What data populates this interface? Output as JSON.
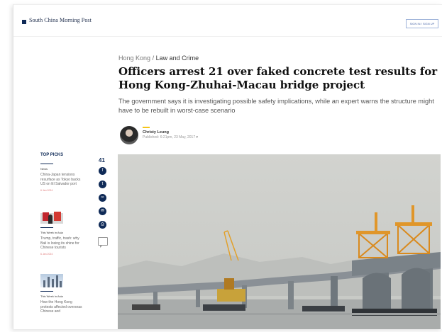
{
  "header": {
    "logo_text": "South China Morning Post",
    "signup_label": "SIGN IN / SIGN UP"
  },
  "article": {
    "breadcrumb_section": "Hong Kong",
    "breadcrumb_sep": "/",
    "breadcrumb_current": "Law and Crime",
    "headline": "Officers arrest 21 over faked concrete test results for Hong Kong-Zhuhai-Macau bridge project",
    "dek": "The government says it is investigating possible safety implications, while an expert warns the structure might have to be rebuilt in worst-case scenario",
    "author_name": "Christy Leung",
    "published": "Published: 6:21pm, 23 May, 2017"
  },
  "top_picks": {
    "title": "TOP PICKS",
    "items": [
      {
        "section": "News",
        "title": "China-Japan tensions resurface as Tokyo backs US on El Salvador port",
        "date": "6 Jan 2024"
      },
      {
        "section": "This Week in Asia",
        "title": "Trump, traffic, trash: why Bali is losing its shine for Chinese tourists",
        "date": "6 Jan 2024"
      },
      {
        "section": "This Week in Asia",
        "title": "How the Hong Kong protests affected overseas Chinese and"
      }
    ]
  },
  "share": {
    "count": "41",
    "icons": [
      "facebook-icon",
      "twitter-icon",
      "link-icon",
      "email-icon",
      "print-icon",
      "comment-icon"
    ]
  },
  "colors": {
    "brand_navy": "#0f2a57",
    "accent_yellow": "#f5c518"
  }
}
